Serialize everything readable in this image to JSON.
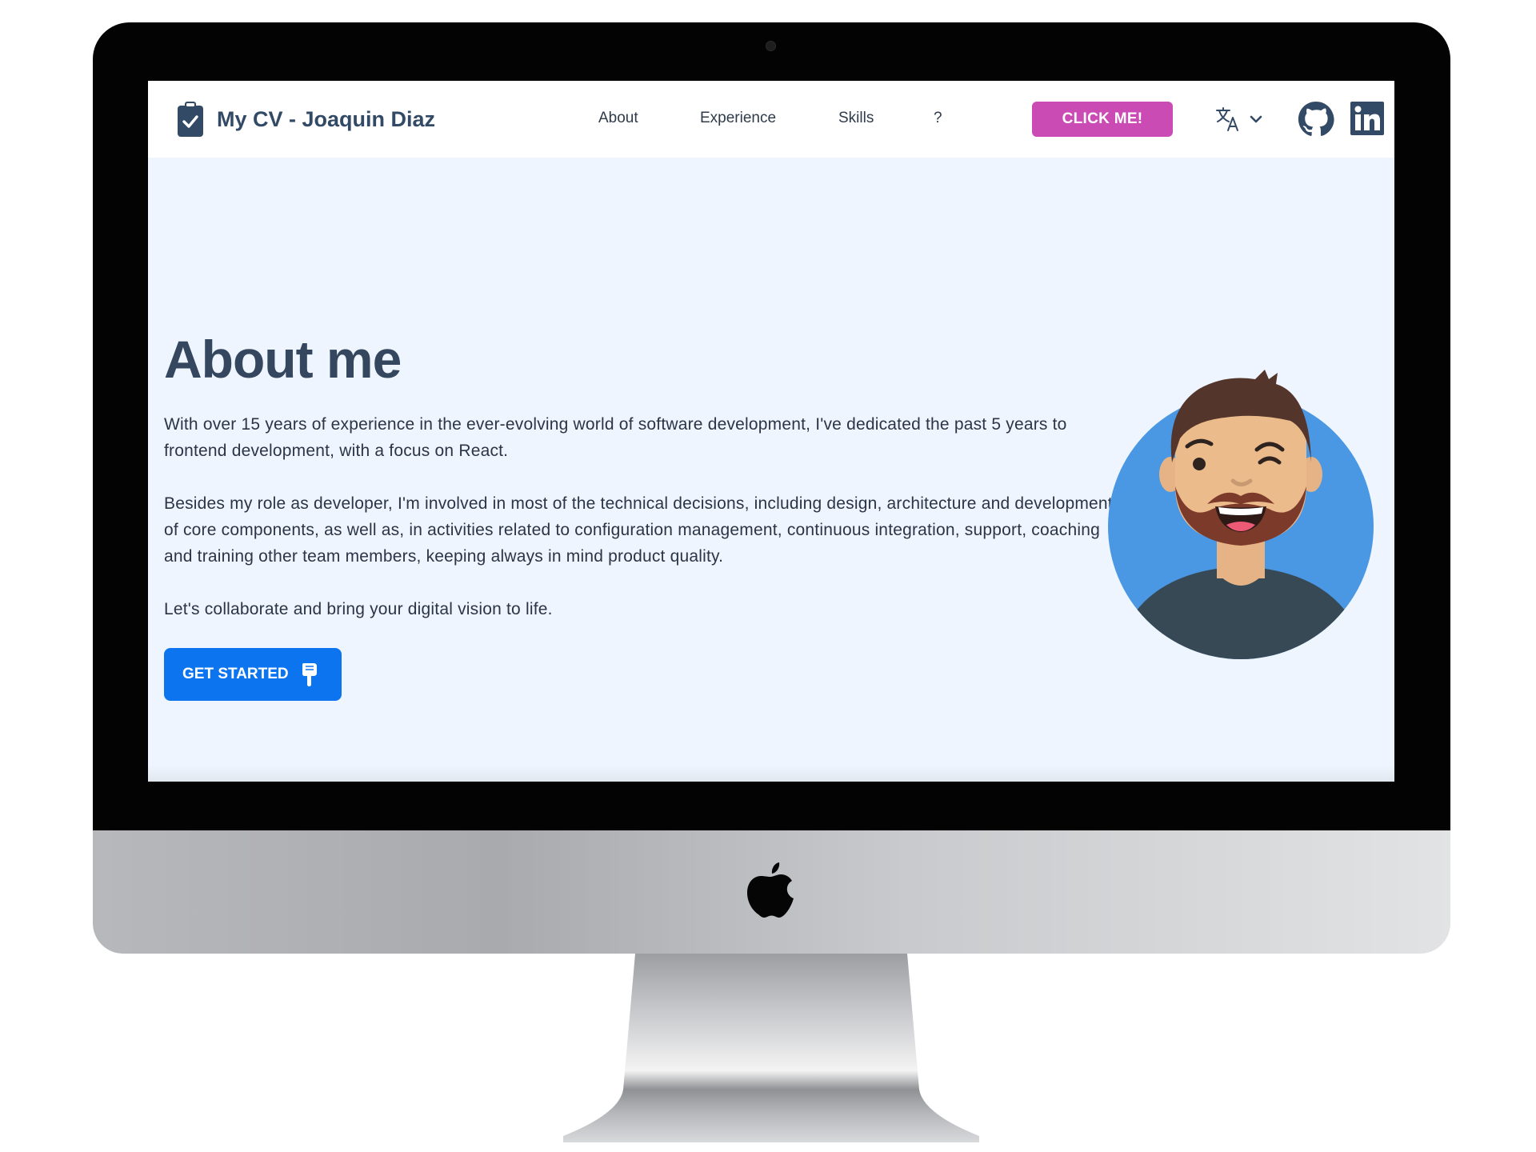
{
  "navbar": {
    "brand_title": "My CV - Joaquin Diaz",
    "links": [
      {
        "label": "About"
      },
      {
        "label": "Experience"
      },
      {
        "label": "Skills"
      },
      {
        "label": "?"
      }
    ],
    "cta_label": "CLICK ME!",
    "language_icon": "translate-icon",
    "social": [
      "github-icon",
      "linkedin-icon"
    ]
  },
  "about": {
    "title": "About me",
    "paragraphs": [
      "With over 15 years of experience in the ever-evolving world of software development, I've dedicated the past 5 years to frontend development, with a focus on React.",
      "Besides my role as developer, I'm involved in most of the technical decisions, including design, architecture and development of core components, as well as, in activities related to configuration management, continuous integration, support, coaching and training other team members, keeping always in mind product quality.",
      "Let's collaborate and bring your digital vision to life."
    ],
    "button_label": "GET STARTED",
    "button_icon": "hand-pointing-down-icon",
    "avatar_icon": "winking-avatar-icon"
  },
  "colors": {
    "accent_pink": "#cb4bb5",
    "primary_blue": "#0d74ef",
    "page_background": "#eef5fe",
    "heading": "#34475f"
  }
}
